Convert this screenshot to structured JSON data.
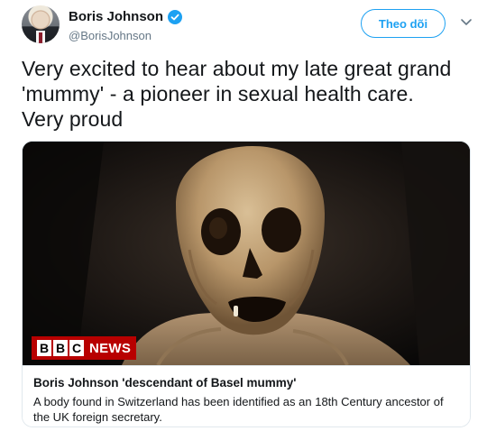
{
  "author": {
    "display_name": "Boris Johnson",
    "handle": "@BorisJohnson",
    "verified": true
  },
  "actions": {
    "follow_label": "Theo dõi"
  },
  "tweet": {
    "text": "Very excited to hear about my late great grand 'mummy' - a pioneer in sexual health care. Very proud"
  },
  "card": {
    "logo_box_letters": [
      "B",
      "B",
      "C"
    ],
    "logo_text": "NEWS",
    "title": "Boris Johnson 'descendant of Basel mummy'",
    "description": "A body found in Switzerland has been identified as an 18th Century ancestor of the UK foreign secretary."
  },
  "colors": {
    "accent": "#1da1f2",
    "bbc_red": "#b80000",
    "text": "#14171a",
    "muted": "#657786"
  }
}
